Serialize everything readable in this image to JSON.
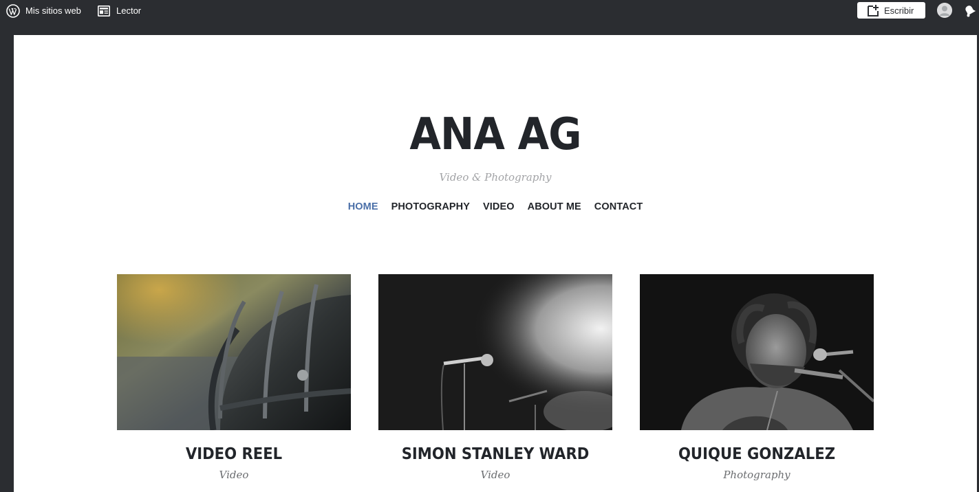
{
  "admin_bar": {
    "my_sites_label": "Mis sitios web",
    "reader_label": "Lector",
    "write_label": "Escribir",
    "icons": {
      "sites": "wordpress-logo-icon",
      "reader": "reader-icon",
      "write": "new-post-icon",
      "avatar": "avatar-icon",
      "notifications": "notifications-bell-icon"
    }
  },
  "site": {
    "title": "ANA AG",
    "tagline": "Video & Photography"
  },
  "nav": {
    "items": [
      {
        "label": "HOME",
        "current": true
      },
      {
        "label": "PHOTOGRAPHY",
        "current": false
      },
      {
        "label": "VIDEO",
        "current": false
      },
      {
        "label": "ABOUT ME",
        "current": false
      },
      {
        "label": "CONTACT",
        "current": false
      }
    ]
  },
  "portfolio": {
    "projects": [
      {
        "title": "VIDEO REEL",
        "category": "Video",
        "image": "motorcycle-photo"
      },
      {
        "title": "SIMON STANLEY WARD",
        "category": "Video",
        "image": "microphone-stage-photo"
      },
      {
        "title": "QUIQUE GONZALEZ",
        "category": "Photography",
        "image": "singer-performing-photo"
      }
    ]
  },
  "colors": {
    "admin_bar_bg": "#2b2d31",
    "text_dark": "#22252a",
    "nav_current": "#4a6fa8",
    "tagline": "#a2a3a6"
  }
}
